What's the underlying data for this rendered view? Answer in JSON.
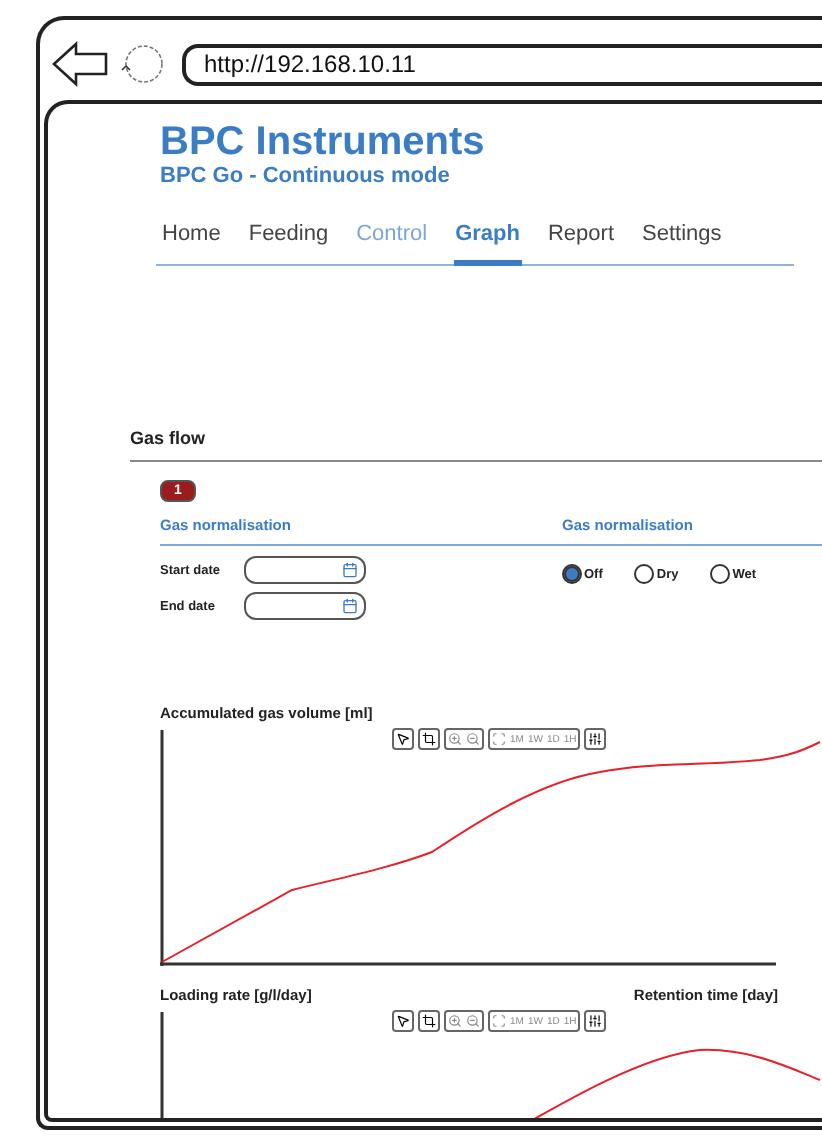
{
  "browser": {
    "url": "http://192.168.10.11"
  },
  "header": {
    "title": "BPC Instruments",
    "subtitle": "BPC Go - Continuous mode"
  },
  "tabs": [
    {
      "label": "Home",
      "selected": false,
      "disabled": false
    },
    {
      "label": "Feeding",
      "selected": false,
      "disabled": false
    },
    {
      "label": "Control",
      "selected": false,
      "disabled": true
    },
    {
      "label": "Graph",
      "selected": true,
      "disabled": false
    },
    {
      "label": "Report",
      "selected": false,
      "disabled": false
    },
    {
      "label": "Settings",
      "selected": false,
      "disabled": false
    }
  ],
  "section": {
    "title": "Gas flow",
    "badge": "1"
  },
  "date_panel": {
    "title": "Gas normalisation",
    "fields": [
      {
        "label": "Start date"
      },
      {
        "label": "End date"
      }
    ]
  },
  "normalisation_panel": {
    "title": "Gas normalisation",
    "options": [
      {
        "label": "Off",
        "selected": true
      },
      {
        "label": "Dry",
        "selected": false
      },
      {
        "label": "Wet",
        "selected": false
      }
    ]
  },
  "charts": [
    {
      "kind": "cumulative",
      "title": "Accumulated gas volume [ml]",
      "ranges": [
        "1M",
        "1W",
        "1D",
        "1H"
      ]
    },
    {
      "kind": "peak",
      "title": "Loading rate [g/l/day]",
      "right_title": "Retention time [day]",
      "ranges": [
        "1M",
        "1W",
        "1D",
        "1H"
      ]
    }
  ]
}
